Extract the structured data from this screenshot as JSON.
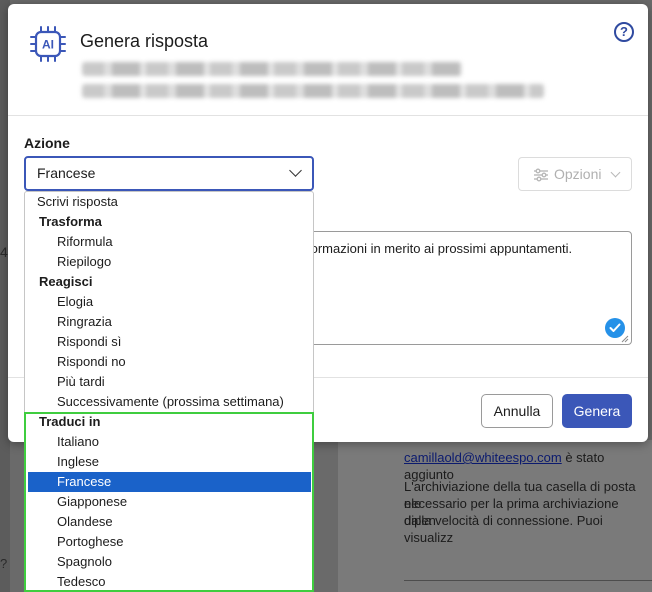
{
  "background": {
    "email_link": "camillaold@whiteespo.com",
    "line1_rest": " è stato aggiunto",
    "line2": "L'archiviazione della tua casella di posta ele",
    "line3": "necessario per la prima archiviazione dipen",
    "line4": "dalla velocità di connessione. Puoi visualizz",
    "left_help": "?",
    "left_number": "4"
  },
  "dialog": {
    "icon_text": "AI",
    "title": "Genera risposta",
    "help_glyph": "?",
    "action_label": "Azione",
    "select_value": "Francese",
    "options_label": "Opzioni",
    "textarea_text": "formazioni in merito ai prossimi appuntamenti.",
    "cancel_label": "Annulla",
    "generate_label": "Genera"
  },
  "dropdown": {
    "items": [
      {
        "label": "Scrivi risposta",
        "kind": "top"
      },
      {
        "label": "Trasforma",
        "kind": "group"
      },
      {
        "label": "Riformula",
        "kind": "child"
      },
      {
        "label": "Riepilogo",
        "kind": "child"
      },
      {
        "label": "Reagisci",
        "kind": "group"
      },
      {
        "label": "Elogia",
        "kind": "child"
      },
      {
        "label": "Ringrazia",
        "kind": "child"
      },
      {
        "label": "Rispondi sì",
        "kind": "child"
      },
      {
        "label": "Rispondi no",
        "kind": "child"
      },
      {
        "label": "Più tardi",
        "kind": "child"
      },
      {
        "label": "Successivamente (prossima settimana)",
        "kind": "child"
      },
      {
        "label": "Traduci in",
        "kind": "group"
      },
      {
        "label": "Italiano",
        "kind": "child"
      },
      {
        "label": "Inglese",
        "kind": "child"
      },
      {
        "label": "Francese",
        "kind": "child",
        "selected": true
      },
      {
        "label": "Giapponese",
        "kind": "child"
      },
      {
        "label": "Olandese",
        "kind": "child"
      },
      {
        "label": "Portoghese",
        "kind": "child"
      },
      {
        "label": "Spagnolo",
        "kind": "child"
      },
      {
        "label": "Tedesco",
        "kind": "child"
      }
    ]
  },
  "colors": {
    "accent": "#3b57b8",
    "selected": "#1a62c9",
    "highlight_box": "#3fcd3f",
    "check": "#2591e8"
  }
}
